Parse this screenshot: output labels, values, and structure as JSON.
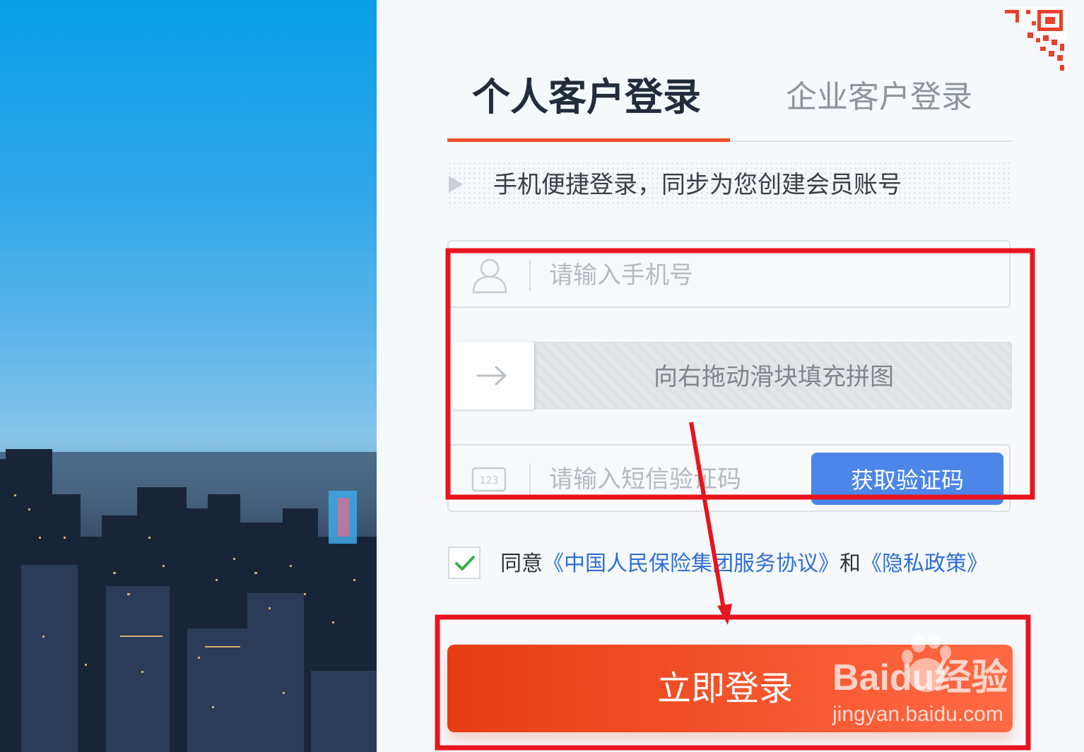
{
  "tabs": {
    "personal": "个人客户登录",
    "enterprise": "企业客户登录"
  },
  "notice": "手机便捷登录，同步为您创建会员账号",
  "phone": {
    "placeholder": "请输入手机号",
    "icon": "user-icon"
  },
  "slider": {
    "text": "向右拖动滑块填充拼图",
    "icon": "arrow-right-icon"
  },
  "sms": {
    "placeholder": "请输入短信验证码",
    "icon": "sms-code-icon",
    "button": "获取验证码"
  },
  "agreement": {
    "checked": true,
    "prefix": "同意",
    "service_link": "《中国人民保险集团服务协议》",
    "conjunction": "和",
    "privacy_link": "《隐私政策》"
  },
  "login_button": "立即登录",
  "watermark": {
    "brand": "Baidu经验",
    "url": "jingyan.baidu.com"
  },
  "colors": {
    "accent": "#f04e2a",
    "sms_button": "#4b86e8",
    "link": "#2f6fd6",
    "annotation": "#e8141e"
  }
}
